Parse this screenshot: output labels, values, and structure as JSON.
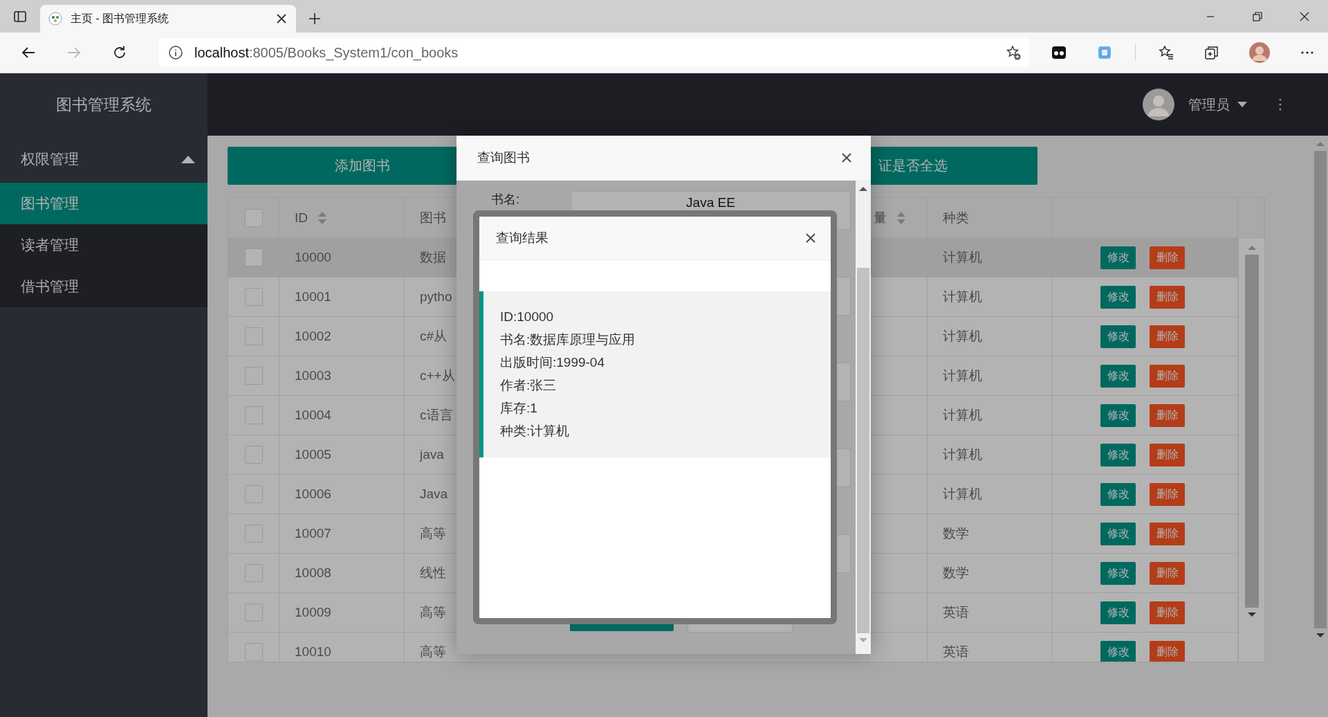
{
  "browser": {
    "tab_title": "主页 - 图书管理系统",
    "address": {
      "host": "localhost",
      "path": ":8005/Books_System1/con_books"
    }
  },
  "header": {
    "logo": "图书管理系统",
    "user": "管理员"
  },
  "sidebar": {
    "items": [
      {
        "label": "权限管理",
        "expanded": true,
        "children": [
          {
            "label": "图书管理",
            "selected": true
          },
          {
            "label": "读者管理",
            "selected": false
          },
          {
            "label": "借书管理",
            "selected": false
          }
        ]
      }
    ]
  },
  "toolbar": {
    "buttons": [
      {
        "label": "添加图书"
      },
      {
        "label": "证是否全选"
      }
    ]
  },
  "table": {
    "all_checked": false,
    "columns": [
      {
        "kind": "check"
      },
      {
        "kind": "text",
        "label": "ID",
        "sortable": true
      },
      {
        "kind": "text",
        "label": "图书"
      },
      {
        "kind": "text",
        "label": "量",
        "sortable": true
      },
      {
        "kind": "text",
        "label": "种类",
        "sortable": false
      },
      {
        "kind": "actions"
      }
    ],
    "rows": [
      {
        "checked": false,
        "highlighted": true,
        "id": "10000",
        "title": "数据",
        "category": "计算机",
        "actions": [
          {
            "kind": "edit",
            "label": "修改"
          },
          {
            "kind": "delete",
            "label": "删除"
          }
        ]
      },
      {
        "checked": false,
        "highlighted": false,
        "id": "10001",
        "title": "pytho",
        "category": "计算机",
        "actions": [
          {
            "kind": "edit",
            "label": "修改"
          },
          {
            "kind": "delete",
            "label": "删除"
          }
        ]
      },
      {
        "checked": false,
        "highlighted": false,
        "id": "10002",
        "title": "c#从",
        "category": "计算机",
        "actions": [
          {
            "kind": "edit",
            "label": "修改"
          },
          {
            "kind": "delete",
            "label": "删除"
          }
        ]
      },
      {
        "checked": false,
        "highlighted": false,
        "id": "10003",
        "title": "c++从",
        "category": "计算机",
        "actions": [
          {
            "kind": "edit",
            "label": "修改"
          },
          {
            "kind": "delete",
            "label": "删除"
          }
        ]
      },
      {
        "checked": false,
        "highlighted": false,
        "id": "10004",
        "title": "c语言",
        "category": "计算机",
        "actions": [
          {
            "kind": "edit",
            "label": "修改"
          },
          {
            "kind": "delete",
            "label": "删除"
          }
        ]
      },
      {
        "checked": false,
        "highlighted": false,
        "id": "10005",
        "title": "java",
        "category": "计算机",
        "actions": [
          {
            "kind": "edit",
            "label": "修改"
          },
          {
            "kind": "delete",
            "label": "删除"
          }
        ]
      },
      {
        "checked": false,
        "highlighted": false,
        "id": "10006",
        "title": "Java",
        "category": "计算机",
        "actions": [
          {
            "kind": "edit",
            "label": "修改"
          },
          {
            "kind": "delete",
            "label": "删除"
          }
        ]
      },
      {
        "checked": false,
        "highlighted": false,
        "id": "10007",
        "title": "高等",
        "category": "数学",
        "actions": [
          {
            "kind": "edit",
            "label": "修改"
          },
          {
            "kind": "delete",
            "label": "删除"
          }
        ]
      },
      {
        "checked": false,
        "highlighted": false,
        "id": "10008",
        "title": "线性",
        "category": "数学",
        "actions": [
          {
            "kind": "edit",
            "label": "修改"
          },
          {
            "kind": "delete",
            "label": "删除"
          }
        ]
      },
      {
        "checked": false,
        "highlighted": false,
        "id": "10009",
        "title": "高等",
        "category": "英语",
        "actions": [
          {
            "kind": "edit",
            "label": "修改"
          },
          {
            "kind": "delete",
            "label": "删除"
          }
        ]
      },
      {
        "checked": false,
        "highlighted": false,
        "id": "10010",
        "title": "高等",
        "category": "英语",
        "actions": [
          {
            "kind": "edit",
            "label": "修改"
          },
          {
            "kind": "delete",
            "label": "删除"
          }
        ]
      }
    ]
  },
  "query_dialog": {
    "title": "查询图书",
    "fields": [
      {
        "kind": "text",
        "label": "书名:",
        "value": "Java EE"
      },
      {
        "kind": "text"
      },
      {
        "kind": "text"
      },
      {
        "kind": "text"
      },
      {
        "kind": "text"
      }
    ],
    "buttons": [
      {
        "kind": "primary"
      },
      {
        "kind": "default"
      }
    ]
  },
  "result_dialog": {
    "title": "查询结果",
    "lines": [
      "ID:10000",
      "书名:数据库原理与应用",
      "出版时间:1999-04",
      "作者:张三",
      "库存:1",
      "种类:计算机"
    ]
  }
}
